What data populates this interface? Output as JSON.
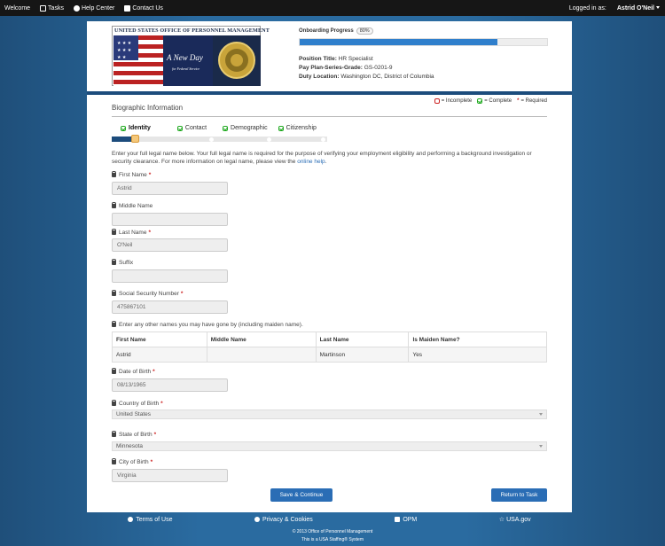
{
  "topnav": {
    "welcome": "Welcome",
    "tasks": "Tasks",
    "help_center": "Help Center",
    "contact_us": "Contact Us",
    "logged_in_as": "Logged in as:",
    "user_name": "Astrid O'Neil"
  },
  "header": {
    "logo_title": "United States Office of Personnel Management",
    "logo_tagline": "A New Day",
    "logo_subtagline": "for Federal Service",
    "progress_label": "Onboarding Progress",
    "progress_pct": "80%",
    "progress_value": 0.8,
    "position_title_label": "Position Title:",
    "position_title": "HR Specialist",
    "pay_plan_label": "Pay Plan-Series-Grade:",
    "pay_plan": "GS-0201-9",
    "duty_location_label": "Duty Location:",
    "duty_location": "Washington DC, District of Columbia"
  },
  "biographic": {
    "title": "Biographic Information",
    "legend_incomplete": "= Incomplete",
    "legend_complete": "= Complete",
    "legend_required": "= Required",
    "steps": [
      "Identity",
      "Contact",
      "Demographic",
      "Citizenship"
    ],
    "intro": "Enter your full legal name below. Your full legal name is required for the purpose of verifying your employment eligibility and performing a background investigation or security clearance. For more information on legal name, please view the",
    "intro_link": "online help",
    "first_name_label": "First Name",
    "first_name": "Astrid",
    "middle_name_label": "Middle Name",
    "middle_name": "",
    "last_name_label": "Last Name",
    "last_name": "O'Neil",
    "suffix_label": "Suffix",
    "suffix": "",
    "ssn_label": "Social Security Number",
    "ssn": "475867101",
    "other_names_label": "Enter any other names you may have gone by (including maiden name).",
    "table_headers": [
      "First Name",
      "Middle Name",
      "Last Name",
      "Is Maiden Name?"
    ],
    "table_row": [
      "Astrid",
      "",
      "Martinson",
      "Yes"
    ],
    "dob_label": "Date of Birth",
    "dob": "08/13/1965",
    "country_label": "Country of Birth",
    "country": "United States",
    "state_label": "State of Birth",
    "state": "Minnesota",
    "city_label": "City of Birth",
    "city": "Virginia",
    "save_button": "Save & Continue",
    "return_button": "Return to Task"
  },
  "footer": {
    "terms": "Terms of Use",
    "privacy": "Privacy & Cookies",
    "opm": "OPM",
    "usagov": "USA.gov",
    "copyright": "© 2013 Office of Personnel Management",
    "system": "This is a USA Staffing® System"
  },
  "colors": {
    "navy": "#1c4c7c",
    "button_blue": "#2a6db5",
    "progress_blue": "#2f7fcc",
    "required_red": "#cc2222",
    "complete_green": "#22aa22"
  }
}
